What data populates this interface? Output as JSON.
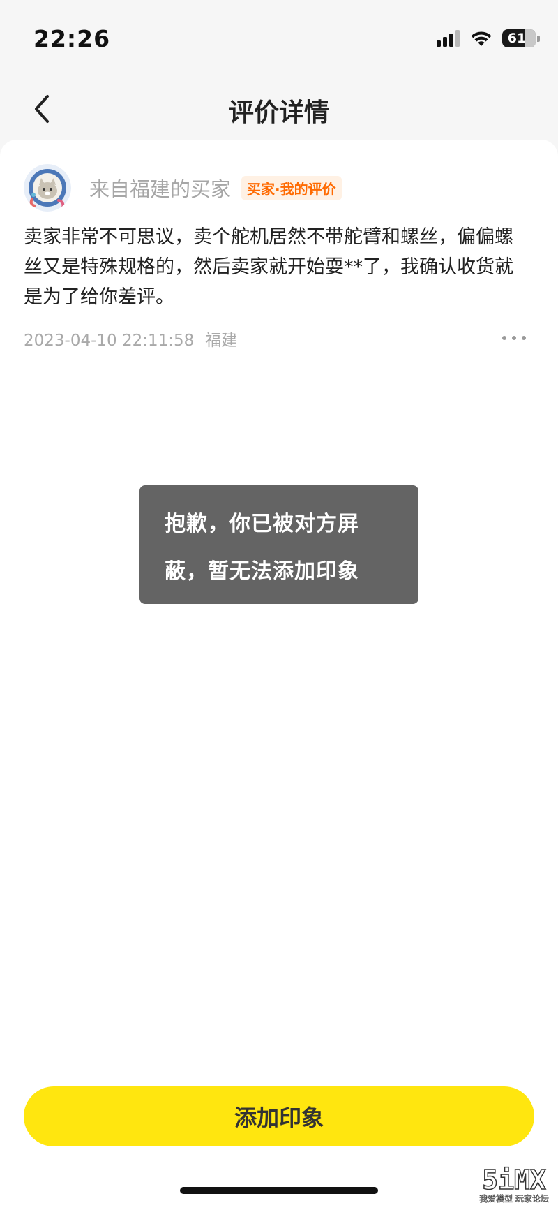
{
  "status_bar": {
    "time": "22:26",
    "battery_level": "61",
    "icons": [
      "signal-icon",
      "wifi-icon",
      "battery-icon"
    ]
  },
  "nav": {
    "back_icon": "chevron-left-icon",
    "title": "评价详情"
  },
  "review": {
    "reviewer_name": "来自福建的买家",
    "role_badge": "买家·我的评价",
    "text": "卖家非常不可思议，卖个舵机居然不带舵臂和螺丝，偏偏螺丝又是特殊规格的，然后卖家就开始耍**了，我确认收货就是为了给你差评。",
    "timestamp": "2023-04-10 22:11:58",
    "location": "福建",
    "more_icon": "more-horizontal-icon"
  },
  "toast": {
    "message": "抱歉，你已被对方屏蔽，暂无法添加印象"
  },
  "primary_action": {
    "label": "添加印象"
  },
  "watermark": {
    "logo": "5iMX",
    "subtitle": "我爱模型 玩家论坛"
  },
  "colors": {
    "accent_yellow": "#ffe60f",
    "badge_orange": "#ff6a00",
    "badge_bg": "#fff1e4",
    "toast_bg": "#5e5e5e"
  }
}
